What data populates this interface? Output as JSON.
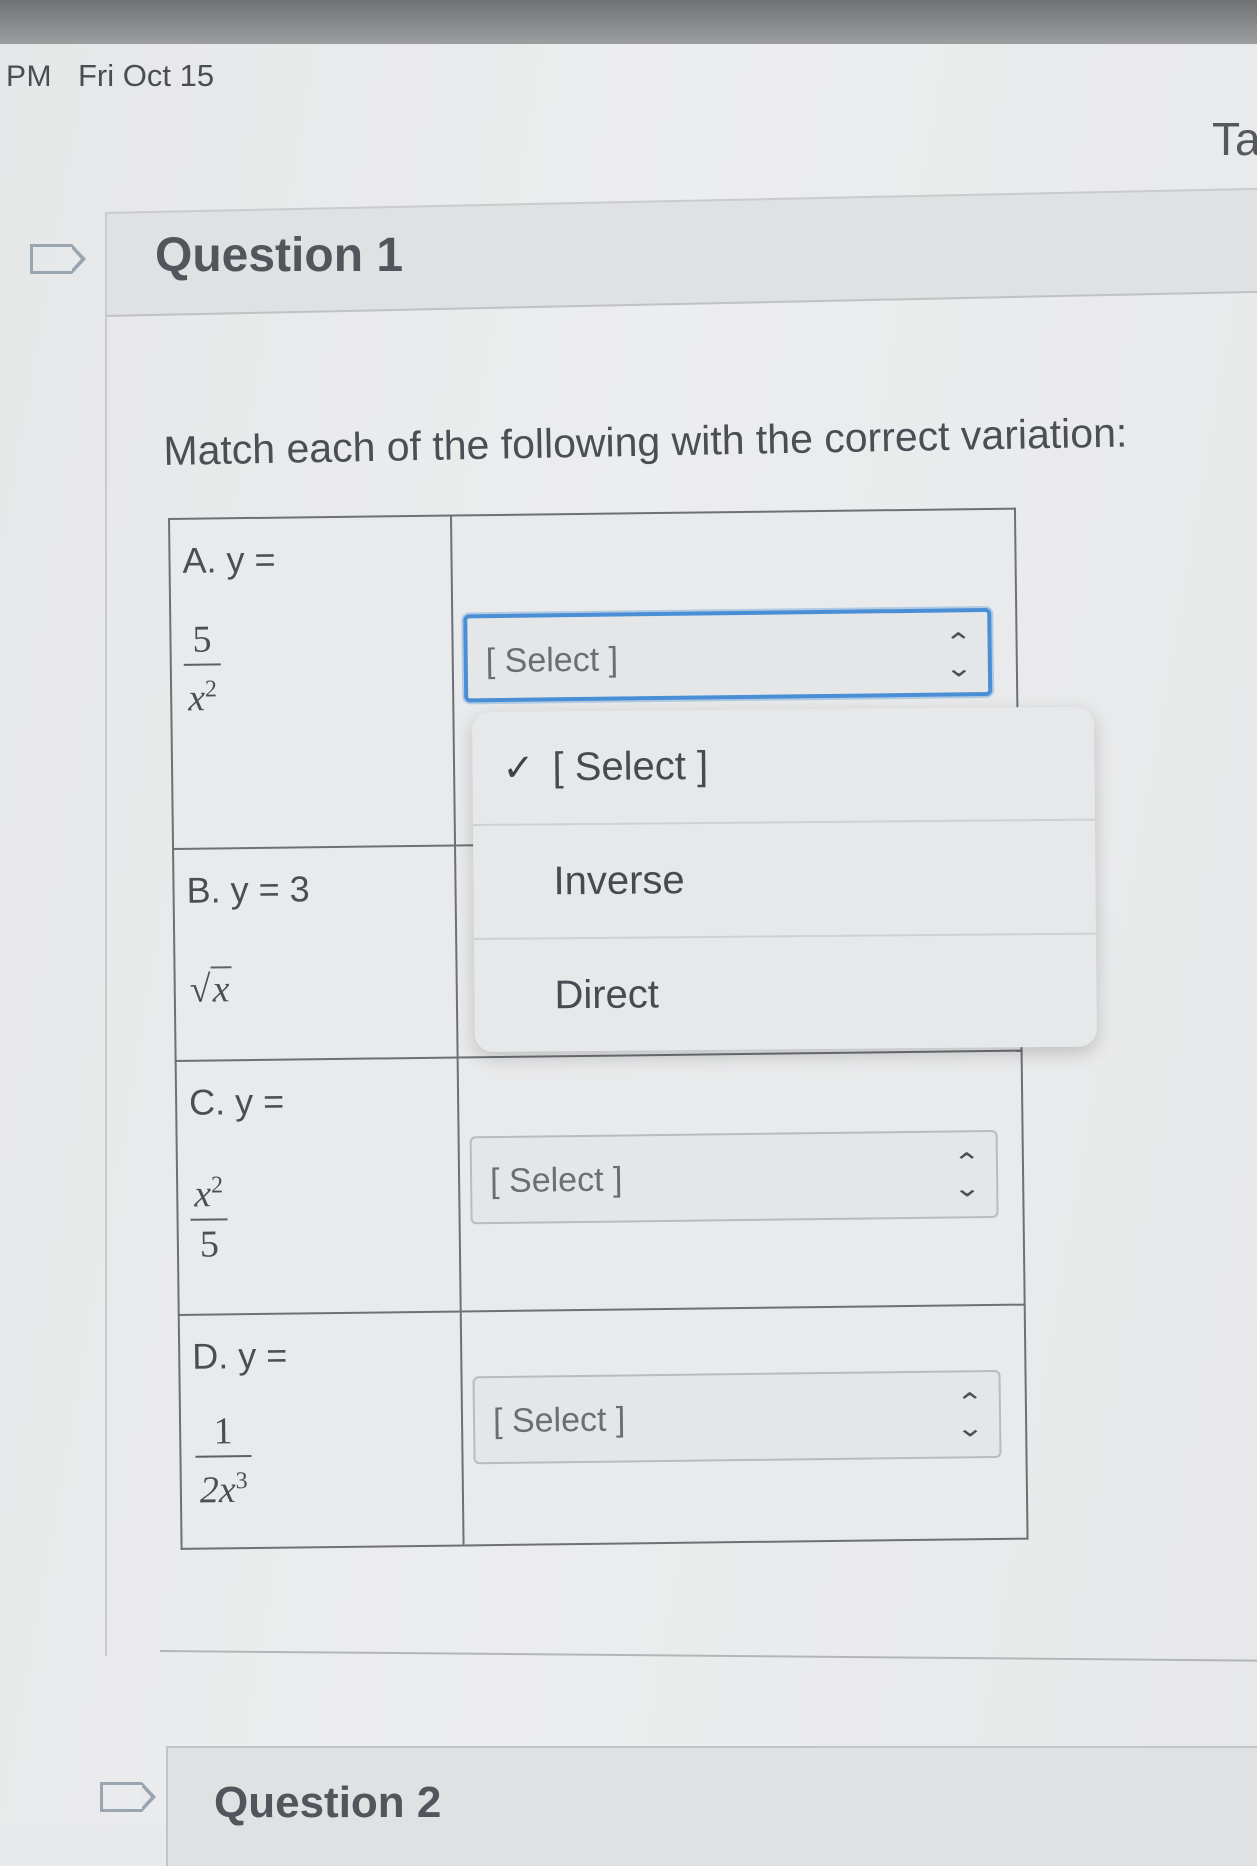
{
  "status_bar": {
    "time": "PM",
    "date": "Fri Oct 15",
    "tab_title_partial": "Ta"
  },
  "question1": {
    "title": "Question 1",
    "prompt": "Match each of the following with the correct variation:",
    "rows": [
      {
        "label": "A.  y =",
        "numerator": "5",
        "denominator_base": "x",
        "denominator_exp": "2",
        "selected": "[ Select ]"
      },
      {
        "label": "B. y = 3",
        "radicand": "x",
        "selected": "[ Select ]"
      },
      {
        "label": "C.  y =",
        "numerator_base": "x",
        "numerator_exp": "2",
        "denominator": "5",
        "selected": "[ Select ]"
      },
      {
        "label": "D. y =",
        "numerator": "1",
        "denominator_base": "2x",
        "denominator_exp": "3",
        "selected": "[ Select ]"
      }
    ],
    "dropdown": {
      "options": [
        {
          "label": "[ Select ]",
          "checked": true
        },
        {
          "label": "Inverse",
          "checked": false
        },
        {
          "label": "Direct",
          "checked": false
        }
      ],
      "check_glyph": "✓"
    }
  },
  "question2": {
    "title": "Question 2"
  },
  "colors": {
    "focus_ring": "#4a8fd6",
    "background": "#e8e9ea",
    "text": "#4a4f55"
  }
}
